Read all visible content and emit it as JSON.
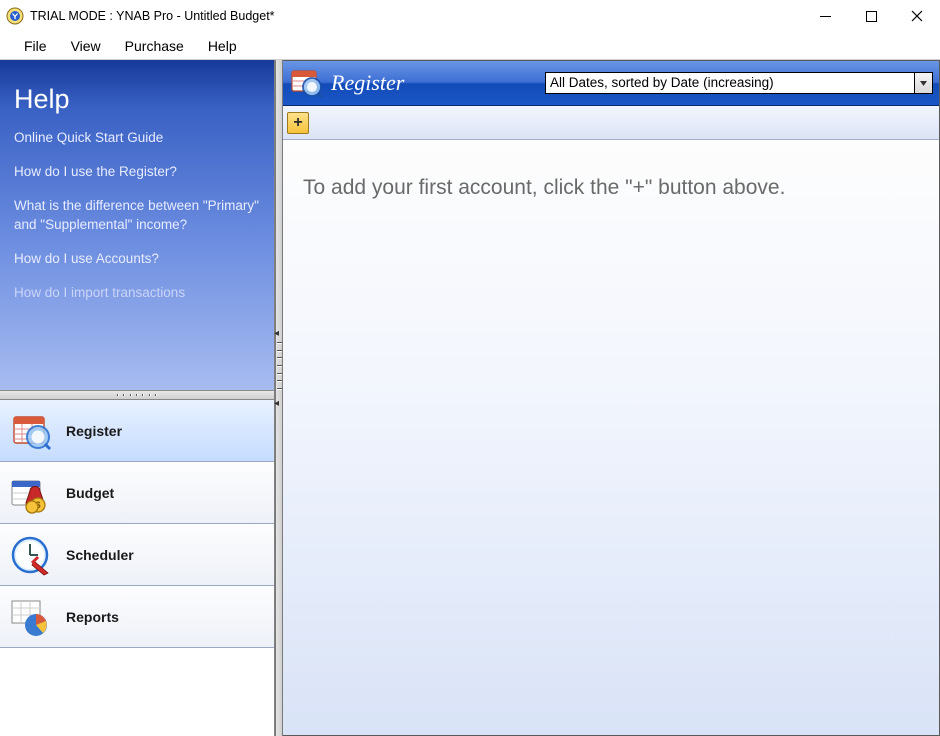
{
  "titlebar": {
    "title": "TRIAL MODE : YNAB Pro - Untitled Budget*"
  },
  "menu": {
    "items": [
      "File",
      "View",
      "Purchase",
      "Help"
    ]
  },
  "help_panel": {
    "title": "Help",
    "links": [
      "Online Quick Start Guide",
      "How do I use the Register?",
      "What is the difference between \"Primary\" and \"Supplemental\" income?",
      "How do I use Accounts?",
      "How do I import transactions"
    ]
  },
  "nav": {
    "items": [
      {
        "label": "Register",
        "icon": "register-icon",
        "selected": true
      },
      {
        "label": "Budget",
        "icon": "budget-icon",
        "selected": false
      },
      {
        "label": "Scheduler",
        "icon": "scheduler-icon",
        "selected": false
      },
      {
        "label": "Reports",
        "icon": "reports-icon",
        "selected": false
      }
    ]
  },
  "register": {
    "title": "Register",
    "filter_text": "All Dates, sorted by Date (increasing)",
    "add_label": "+",
    "hint": "To add your first account, click the \"+\" button above."
  }
}
